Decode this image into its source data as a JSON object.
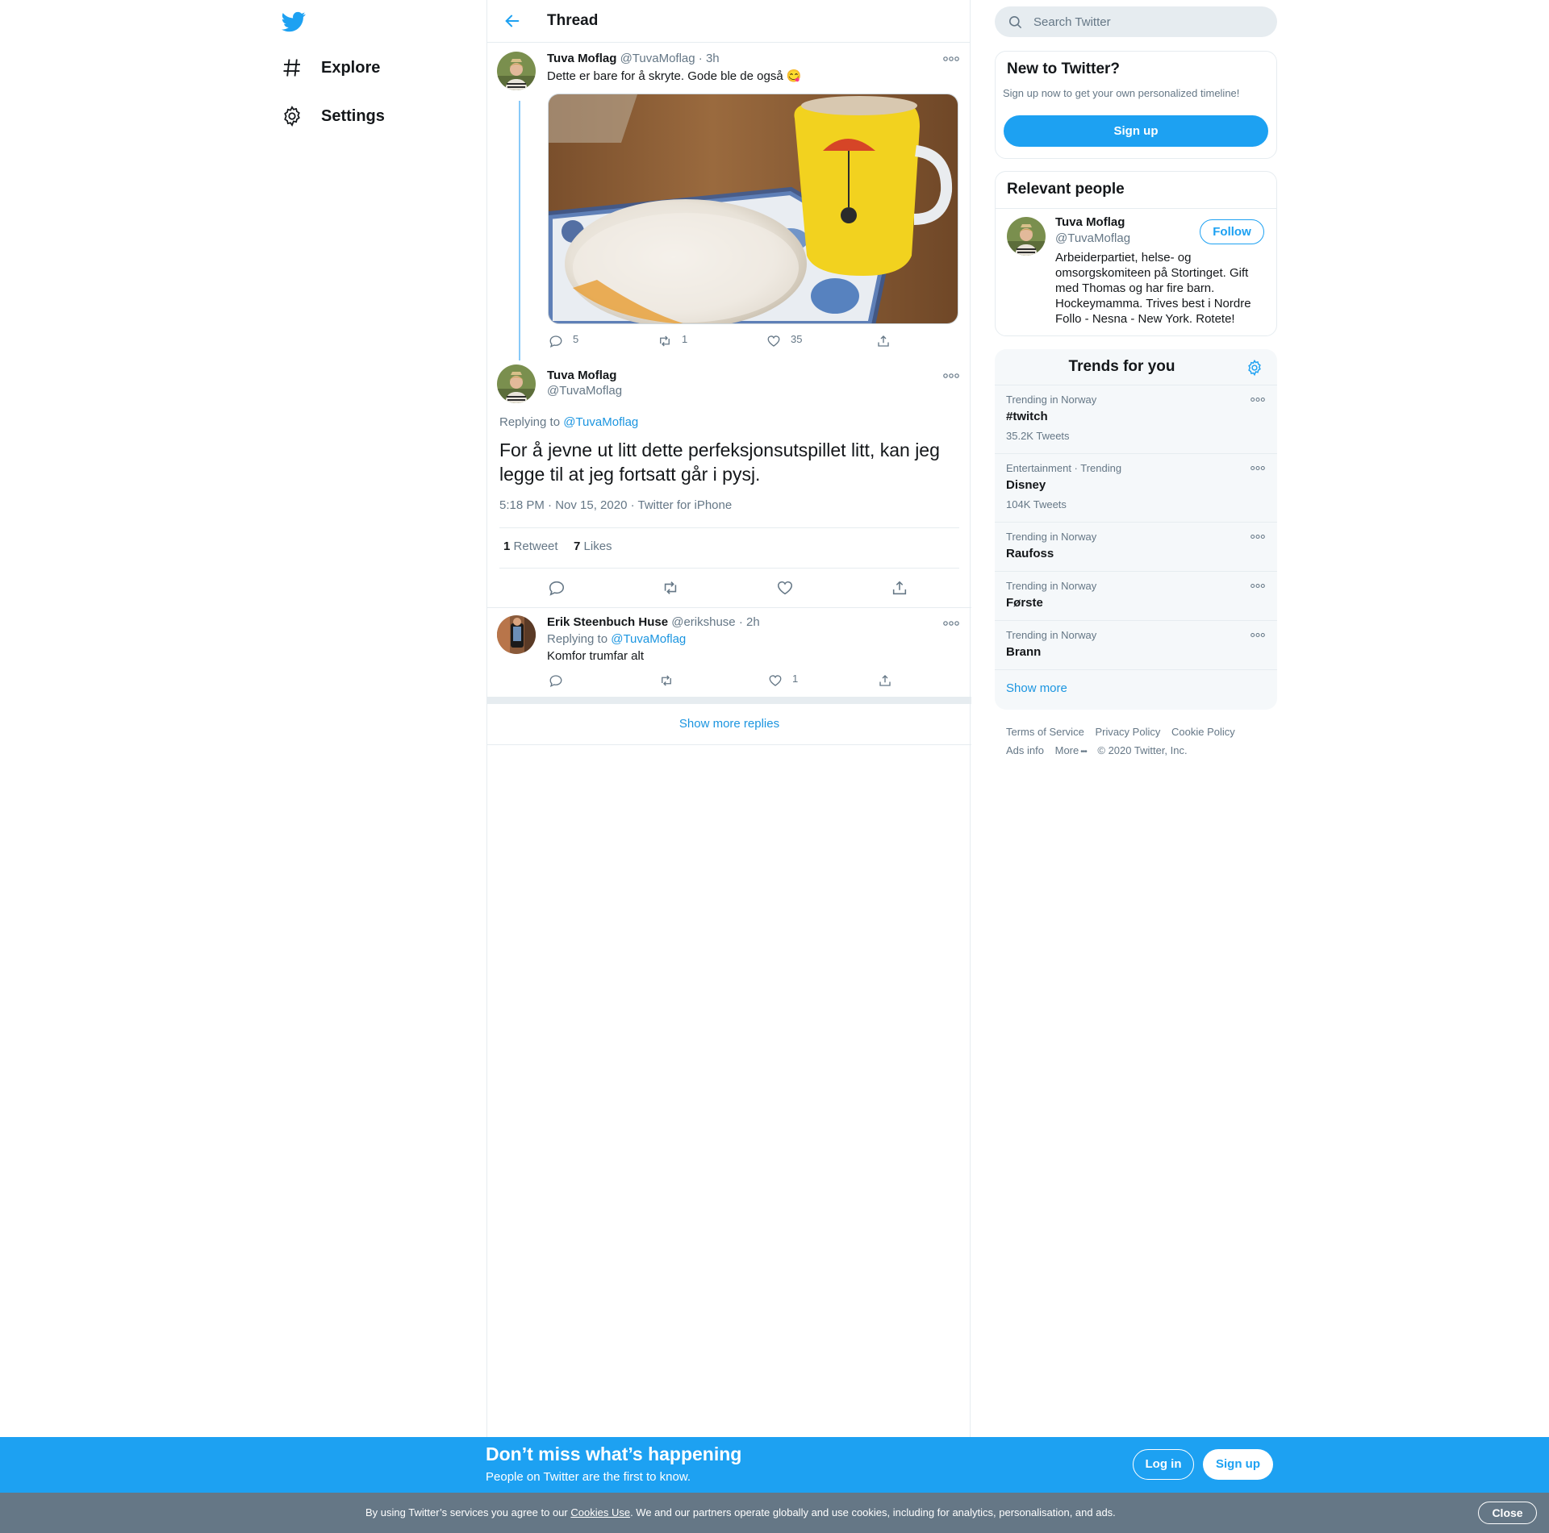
{
  "nav": {
    "logo_icon": "twitter-bird-icon",
    "items": [
      {
        "label": "Explore",
        "icon": "hashtag-icon"
      },
      {
        "label": "Settings",
        "icon": "gear-icon"
      }
    ]
  },
  "thread": {
    "title": "Thread",
    "parent_tweet": {
      "name": "Tuva Moflag",
      "handle": "@TuvaMoflag",
      "time": "· 3h",
      "text": "Dette er bare for å skryte. Gode ble de også 😋",
      "replies": "5",
      "retweets": "1",
      "likes": "35"
    },
    "main_tweet": {
      "name": "Tuva Moflag",
      "handle": "@TuvaMoflag",
      "replying_prefix": "Replying to",
      "replying_to": "@TuvaMoflag",
      "text": "For å jevne ut litt dette perfeksjonsutspillet litt, kan jeg legge til at jeg fortsatt går i pysj.",
      "timestamp": "5:18 PM · Nov 15, 2020 · Twitter for iPhone",
      "retweet_count": "1",
      "retweet_label": "Retweet",
      "likes_count": "7",
      "likes_label": "Likes"
    },
    "reply": {
      "name": "Erik Steenbuch Huse",
      "handle": "@erikshuse",
      "time": "· 2h",
      "replying_prefix": "Replying to",
      "replying_to": "@TuvaMoflag",
      "text": "Komfor trumfar alt",
      "replies": "",
      "retweets": "",
      "likes": "1"
    },
    "show_more_replies": "Show more replies"
  },
  "sidebar": {
    "search_placeholder": "Search Twitter",
    "new_card": {
      "title": "New to Twitter?",
      "subtitle": "Sign up now to get your own personalized timeline!",
      "button": "Sign up"
    },
    "relevant": {
      "title": "Relevant people",
      "name": "Tuva Moflag",
      "handle": "@TuvaMoflag",
      "follow": "Follow",
      "bio": "Arbeiderpartiet, helse- og omsorgskomiteen på Stortinget. Gift med Thomas og har fire barn. Hockeymamma. Trives best i Nordre Follo - Nesna - New York. Rotete!"
    },
    "trends": {
      "title": "Trends for you",
      "items": [
        {
          "context": "Trending in Norway",
          "name": "#twitch",
          "count": "35.2K Tweets"
        },
        {
          "context": "Entertainment · Trending",
          "name": "Disney",
          "count": "104K Tweets"
        },
        {
          "context": "Trending in Norway",
          "name": "Raufoss",
          "count": ""
        },
        {
          "context": "Trending in Norway",
          "name": "Første",
          "count": ""
        },
        {
          "context": "Trending in Norway",
          "name": "Brann",
          "count": ""
        }
      ],
      "show_more": "Show more"
    },
    "footer": {
      "terms": "Terms of Service",
      "privacy": "Privacy Policy",
      "cookie": "Cookie Policy",
      "ads": "Ads info",
      "more": "More",
      "copyright": "© 2020 Twitter, Inc."
    }
  },
  "signup_bar": {
    "headline": "Don’t miss what’s happening",
    "sub": "People on Twitter are the first to know.",
    "login": "Log in",
    "signup": "Sign up"
  },
  "cookie_bar": {
    "prefix": "By using Twitter’s services you agree to our",
    "link": "Cookies Use",
    "suffix": ". We and our partners operate globally and use cookies, including for analytics, personalisation, and ads.",
    "close": "Close"
  },
  "colors": {
    "accent": "#1da1f2",
    "link": "#1b95e0",
    "text": "#14171a",
    "muted": "#657786",
    "border": "#e6ecf0",
    "cookie_bar": "#657786"
  }
}
